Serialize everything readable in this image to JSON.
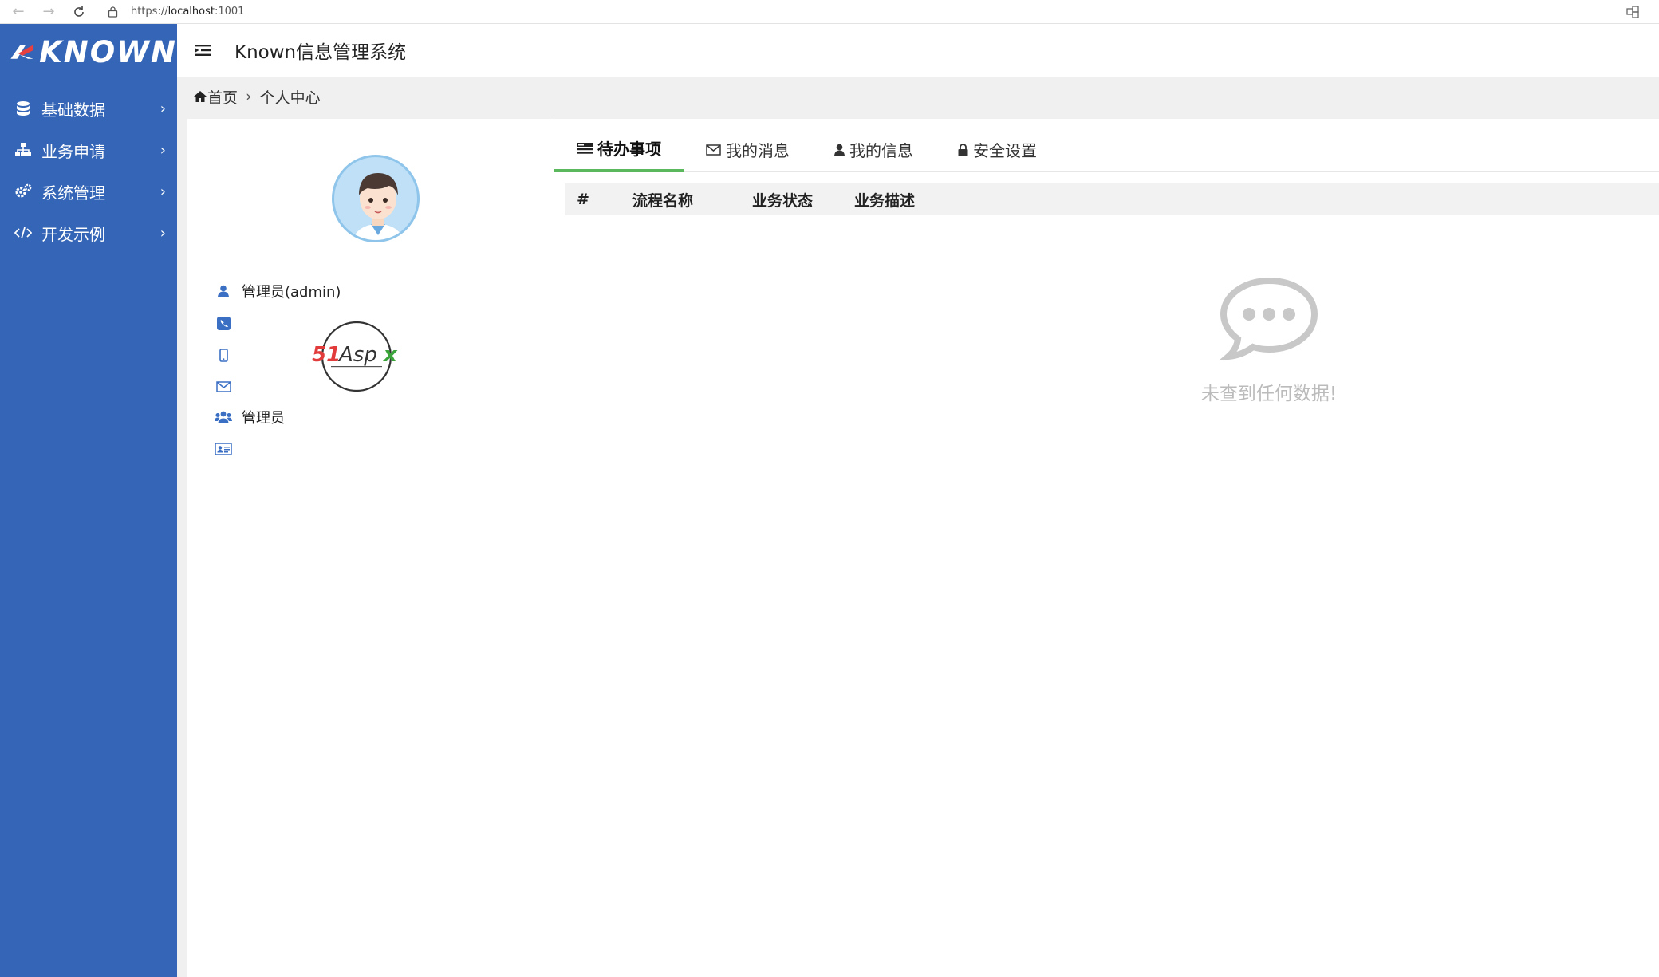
{
  "browser": {
    "url_scheme": "https://",
    "url_host": "localhost",
    "url_port": ":1001"
  },
  "app": {
    "logo_text": "KNOWN",
    "title": "Known信息管理系统"
  },
  "sidebar": {
    "items": [
      {
        "label": "基础数据",
        "icon": "database-icon"
      },
      {
        "label": "业务申请",
        "icon": "sitemap-icon"
      },
      {
        "label": "系统管理",
        "icon": "gears-icon"
      },
      {
        "label": "开发示例",
        "icon": "code-icon"
      }
    ]
  },
  "breadcrumb": {
    "home": "首页",
    "current": "个人中心"
  },
  "profile": {
    "name": "管理员(admin)",
    "phone": "",
    "mobile": "",
    "email": "",
    "role": "管理员",
    "id_card": ""
  },
  "tabs": [
    {
      "label": "待办事项",
      "icon": "list-icon",
      "active": true
    },
    {
      "label": "我的消息",
      "icon": "envelope-icon",
      "active": false
    },
    {
      "label": "我的信息",
      "icon": "user-icon",
      "active": false
    },
    {
      "label": "安全设置",
      "icon": "lock-icon",
      "active": false
    }
  ],
  "table": {
    "columns": [
      "#",
      "流程名称",
      "业务状态",
      "业务描述"
    ]
  },
  "empty_state": {
    "text": "未查到任何数据!"
  },
  "colors": {
    "sidebar": "#3465b6",
    "active_tab_underline": "#5cb85c",
    "icon_blue": "#3a6fc4",
    "empty_gray": "#c8c8c8"
  }
}
